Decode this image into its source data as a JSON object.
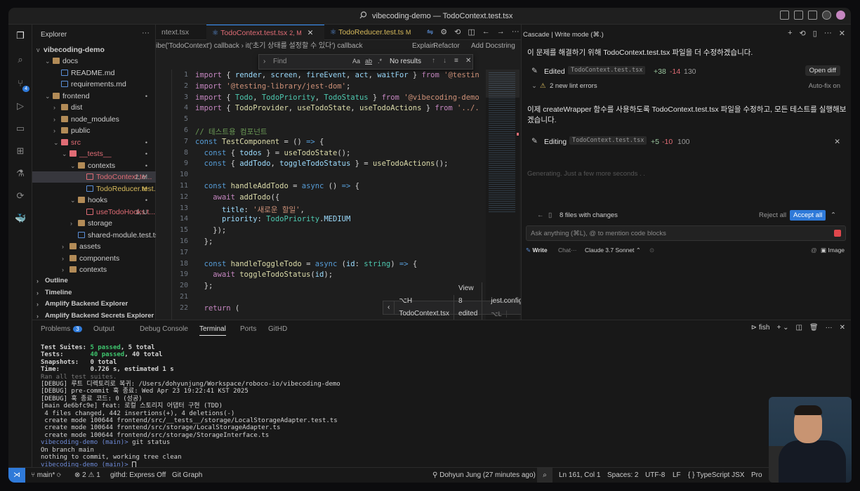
{
  "window": {
    "title": "vibecoding-demo — TodoContext.test.tsx"
  },
  "activity_badge": "4",
  "explorer": {
    "header": "Explorer",
    "root": "vibecoding-demo",
    "tree": [
      {
        "name": "docs",
        "indent": 1,
        "arrow": "v",
        "kind": "folder"
      },
      {
        "name": "README.md",
        "indent": 2,
        "arrow": "",
        "kind": "file",
        "color": "#5a8fd8",
        "clip": true
      },
      {
        "name": "requirements.md",
        "indent": 2,
        "arrow": "",
        "kind": "file",
        "color": "#5a8fd8"
      },
      {
        "name": "frontend",
        "indent": 1,
        "arrow": "v",
        "kind": "folder",
        "dec": "•"
      },
      {
        "name": "dist",
        "indent": 2,
        "arrow": ">",
        "kind": "folder"
      },
      {
        "name": "node_modules",
        "indent": 2,
        "arrow": ">",
        "kind": "folder"
      },
      {
        "name": "public",
        "indent": 2,
        "arrow": ">",
        "kind": "folder"
      },
      {
        "name": "src",
        "indent": 2,
        "arrow": "v",
        "kind": "folder",
        "color": "#e06c75",
        "dec": "•"
      },
      {
        "name": "__tests__",
        "indent": 3,
        "arrow": "v",
        "kind": "folder",
        "color": "#e06c75",
        "dec": "•"
      },
      {
        "name": "contexts",
        "indent": 4,
        "arrow": "v",
        "kind": "folder",
        "dec": "•"
      },
      {
        "name": "TodoContext.te...",
        "indent": 5,
        "arrow": "",
        "kind": "file",
        "color": "#e06c75",
        "dec": "2, M",
        "selected": true
      },
      {
        "name": "TodoReducer.test...",
        "indent": 5,
        "arrow": "",
        "kind": "file",
        "dec": "M"
      },
      {
        "name": "hooks",
        "indent": 4,
        "arrow": "v",
        "kind": "folder",
        "dec": "•"
      },
      {
        "name": "useTodoHooks.t...",
        "indent": 5,
        "arrow": "",
        "kind": "file",
        "color": "#e06c75",
        "dec": "1, U"
      },
      {
        "name": "storage",
        "indent": 4,
        "arrow": ">",
        "kind": "folder"
      },
      {
        "name": "shared-module.test.ts",
        "indent": 4,
        "arrow": "",
        "kind": "file"
      },
      {
        "name": "assets",
        "indent": 3,
        "arrow": ">",
        "kind": "folder"
      },
      {
        "name": "components",
        "indent": 3,
        "arrow": ">",
        "kind": "folder"
      },
      {
        "name": "contexts",
        "indent": 3,
        "arrow": ">",
        "kind": "folder",
        "clip": true
      }
    ],
    "sections": [
      "Outline",
      "Timeline",
      "Amplify Backend Explorer",
      "Amplify Backend Secrets Explorer"
    ]
  },
  "editor": {
    "tabs": [
      {
        "label": "ntext.tsx",
        "active": false
      },
      {
        "label": "TodoContext.test.tsx",
        "badge": "2, M",
        "active": true
      },
      {
        "label": "TodoReducer.test.ts",
        "badge": "M",
        "active": false
      }
    ],
    "breadcrumb": "ibe('TodoContext') callback  ›  it('초기 상태를 설정할 수 있다') callback",
    "lens": [
      "Explain",
      "Refactor",
      "Add Docstring"
    ],
    "find": {
      "placeholder": "Find",
      "result": "No results"
    },
    "lines": [
      {
        "n": "1",
        "html": "<span class='pr'>import</span> { <span class='va'>render</span>, <span class='va'>screen</span>, <span class='va'>fireEvent</span>, <span class='va'>act</span>, <span class='va'>waitFor</span> } <span class='pr'>from</span> <span class='st'>'@testin</span>"
      },
      {
        "n": "2",
        "html": "<span class='pr'>import</span> <span class='st'>'@testing-library/jest-dom'</span>;"
      },
      {
        "n": "3",
        "html": "<span class='pr'>import</span> { <span class='ty'>Todo</span>, <span class='ty'>TodoPriority</span>, <span class='ty'>TodoStatus</span> } <span class='pr'>from</span> <span class='st'>'@vibecoding-demo</span>"
      },
      {
        "n": "4",
        "html": "<span class='pr'>import</span> { <span class='fn'>TodoProvider</span>, <span class='fn'>useTodoState</span>, <span class='fn'>useTodoActions</span> } <span class='pr'>from</span> <span class='st'>'../.</span>"
      },
      {
        "n": "5",
        "html": ""
      },
      {
        "n": "6",
        "html": "<span class='cm'>// 테스트용 컴포넌트</span>"
      },
      {
        "n": "7",
        "html": "<span class='kw'>const</span> <span class='fn'>TestComponent</span> = () <span class='kw'>=></span> {"
      },
      {
        "n": "8",
        "html": "  <span class='kw'>const</span> { <span class='va'>todos</span> } = <span class='fn'>useTodoState</span>();"
      },
      {
        "n": "9",
        "html": "  <span class='kw'>const</span> { <span class='va'>addTodo</span>, <span class='va'>toggleTodoStatus</span> } = <span class='fn'>useTodoActions</span>();"
      },
      {
        "n": "10",
        "html": ""
      },
      {
        "n": "11",
        "html": "  <span class='kw'>const</span> <span class='fn'>handleAddTodo</span> = <span class='kw'>async</span> () <span class='kw'>=></span> {"
      },
      {
        "n": "12",
        "html": "    <span class='pr'>await</span> <span class='fn'>addTodo</span>({"
      },
      {
        "n": "13",
        "html": "      <span class='va'>title</span>: <span class='st'>'새로운 할일'</span>,"
      },
      {
        "n": "14",
        "html": "      <span class='va'>priority</span>: <span class='ty'>TodoPriority</span>.<span class='va'>MEDIUM</span>"
      },
      {
        "n": "15",
        "html": "    });"
      },
      {
        "n": "16",
        "html": "  };"
      },
      {
        "n": "17",
        "html": ""
      },
      {
        "n": "18",
        "html": "  <span class='kw'>const</span> <span class='fn'>handleToggleTodo</span> = <span class='kw'>async</span> (<span class='va'>id</span>: <span class='ty'>string</span>) <span class='kw'>=></span> {"
      },
      {
        "n": "19",
        "html": "    <span class='pr'>await</span> <span class='fn'>toggleTodoStatus</span>(<span class='va'>id</span>);"
      },
      {
        "n": "20",
        "html": "  };"
      },
      {
        "n": "21",
        "html": ""
      },
      {
        "n": "22",
        "html": "  <span class='pr'>return</span> ("
      }
    ],
    "edit_bar": {
      "file": "⌥H TodoContext.tsx",
      "view": "View 8 edited files",
      "config": "jest.config.js",
      "shortcut": "⌥L"
    }
  },
  "cascade": {
    "title": "Cascade | Write mode (⌘.)",
    "msg1": "이 문제를 해결하기 위해 TodoContext.test.tsx 파일을 더 수정하겠습니다.",
    "edited": {
      "label": "Edited",
      "file": "TodoContext.test.tsx",
      "add": "+38",
      "del": "-14",
      "lines": "130",
      "btn": "Open diff"
    },
    "lint": {
      "text": "2 new lint errors",
      "autofix": "Auto-fix on"
    },
    "msg2": "이제 createWrapper 함수를 사용하도록 TodoContext.test.tsx 파일을 수정하고, 모든 테스트를 실행해보겠습니다.",
    "editing": {
      "label": "Editing",
      "file": "TodoContext.test.tsx",
      "add": "+5",
      "del": "-10",
      "lines": "100"
    },
    "generating": "Generating.  Just a few more seconds . .",
    "changes": {
      "text": "8 files with changes",
      "reject": "Reject all",
      "accept": "Accept all"
    },
    "input_placeholder": "Ask anything (⌘L), @ to mention code blocks",
    "mode_write": "Write",
    "mode_chat": "Chat",
    "model": "Claude 3.7 Sonnet",
    "image_btn": "Image"
  },
  "panel": {
    "tabs": [
      "Problems",
      "Output",
      "Debug Console",
      "Terminal",
      "Ports",
      "GitHD"
    ],
    "problems_badge": "3",
    "active_tab": "Terminal",
    "shell": "fish"
  },
  "terminal": [
    {
      "t": "Test Suites: ",
      "c": ""
    },
    {
      "t": "Tests:",
      "c": ""
    },
    {
      "t": "Snapshots:",
      "c": ""
    },
    {
      "t": "Time:",
      "c": ""
    }
  ],
  "terminal_text": {
    "l1a": "Test Suites: ",
    "l1b": "5 passed",
    "l1c": ", 5 total",
    "l2a": "Tests:       ",
    "l2b": "40 passed",
    "l2c": ", 40 total",
    "l3": "Snapshots:   0 total",
    "l4": "Time:        0.726 s, estimated 1 s",
    "l5": "Ran all test suites.",
    "l6": "[DEBUG] 루트 디렉토리로 복귀: /Users/dohyunjung/Workspace/roboco-io/vibecoding-demo",
    "l7": "[DEBUG] pre-commit 훅 종료: Wed Apr 23 19:22:41 KST 2025",
    "l8": "[DEBUG] 훅 종료 코드: 0 (성공)",
    "l9": "[main de6bfc9e] feat: 로컬 스토리지 어댑터 구현 (TDD)",
    "l10": " 4 files changed, 442 insertions(+), 4 deletions(-)",
    "l11": " create mode 100644 frontend/src/__tests__/storage/LocalStorageAdapter.test.ts",
    "l12": " create mode 100644 frontend/src/storage/LocalStorageAdapter.ts",
    "l13": " create mode 100644 frontend/src/storage/StorageInterface.ts",
    "p1a": "vibecoding-demo",
    "p1b": " (main)> ",
    "p1c": "git status",
    "l15": "On branch main",
    "l16": "nothing to commit, working tree clean",
    "p2a": "vibecoding-demo",
    "p2b": " (main)> "
  },
  "status": {
    "branch": "main*",
    "errors": "⊗ 2 ⚠ 1",
    "githd": "githd: Express Off",
    "gitgraph": "Git Graph",
    "author": "Dohyun Jung (27 minutes ago)",
    "pos": "Ln 161, Col 1",
    "spaces": "Spaces: 2",
    "enc": "UTF-8",
    "eol": "LF",
    "lang": "{ } TypeScript JSX",
    "pro": "Pro",
    "w": "W"
  }
}
